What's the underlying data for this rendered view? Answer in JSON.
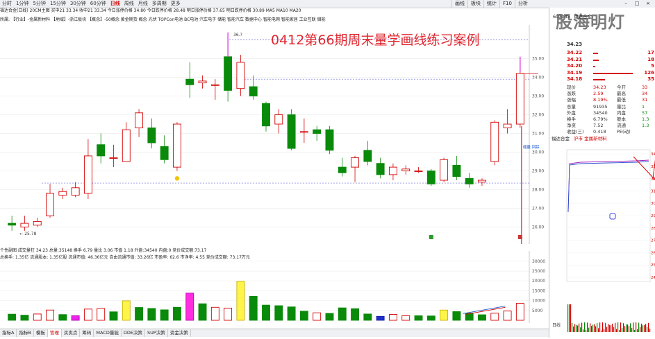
{
  "topbar": {
    "periods": [
      "1分钟",
      "5分钟",
      "15分钟",
      "30分钟",
      "60分钟",
      "日线",
      "周线",
      "月线",
      "多周期",
      "更多"
    ],
    "periods_prefix": [
      "分时",
      "1分钟"
    ],
    "active_period": "日线",
    "tools": [
      "画线",
      "板块",
      "统计",
      "F10",
      "分析"
    ]
  },
  "infobar": {
    "text": "福达合金(日线)  20CM主图  买中21  33.34  收中21  33.34  今日涨停价格 34.80  今日跌停价格 28.48  明日涨停价格 37.65  明日跌停价格 30.89  MA5  MA10  MA20"
  },
  "conceptbar": {
    "text": "所属:  【行业】-金属新材料 【地域】-浙江板块  【概念】-50概念 黄金期货 概念 光伏 TOPCon电池 BC电池 汽车电子 储能 智能汽车 数据中心 智能电网 智能家居 工业互联 储能"
  },
  "overlay_title": "0412第66期周末量学画线练习案例",
  "price_axis": [
    "35.00",
    "34.00",
    "33.00",
    "32.00",
    "31.00",
    "30.00",
    "29.00",
    "28.00",
    "27.00",
    "26.00"
  ],
  "annotations": {
    "high": "36.?",
    "low": "25.78",
    "note": "缩量 回踩"
  },
  "indicator_bar": {
    "text": "个性副图  成交量柱  34.23  总量:35148  换手 6.79  量比 3.06  市值 1.18  外盘:34540  内盘:0  竞价成交额:73.17"
  },
  "stat_bar": {
    "text": "总换手:  1.35亿  流通股本:  1.35亿股   流通市值:  46.36亿元    自由流通市值:  33.26亿          市盈率:  62.6      市净率:  4.55           竞价成交额:  73.17万元"
  },
  "volume_axis": [
    "30000",
    "25000",
    "20000",
    "15000",
    "10000",
    "5000"
  ],
  "bottom_tabs": [
    "指标A",
    "指标B",
    "模板",
    "管理",
    "买卖点",
    "筹码",
    "MACD量能",
    "DDE决策",
    "SUP决策",
    "资金决策"
  ],
  "active_bottom_tab": "管理",
  "right_panel": {
    "logo": "股海明灯",
    "stock_code": "603045",
    "stock_name": "福达合金",
    "orderbook": [
      {
        "price": "34.22",
        "vol": "17"
      },
      {
        "price": "34.21",
        "vol": "18"
      },
      {
        "price": "34.20",
        "vol": "5"
      },
      {
        "price": "34.19",
        "vol": "126"
      },
      {
        "price": "34.18",
        "vol": "35"
      }
    ],
    "orderbook_bars": [
      0.12,
      0.13,
      0.05,
      0.95,
      0.28
    ],
    "top_labels": [
      "34.23"
    ],
    "quote": [
      [
        "现价",
        "34.23",
        "今开",
        "33"
      ],
      [
        "涨跌",
        "2.59",
        "最高",
        "34"
      ],
      [
        "涨幅",
        "8.19%",
        "最低",
        "31"
      ],
      [
        "总量",
        "91935",
        "量比",
        "1"
      ],
      [
        "外盘",
        "34540",
        "内盘",
        "57"
      ],
      [
        "换手",
        "6.79%",
        "股本",
        "1.3"
      ],
      [
        "净资",
        "7.52",
        "流通",
        "1.3"
      ],
      [
        "收益(三)",
        "0.418",
        "PE(动)",
        ""
      ]
    ],
    "mini_title": "福达合金",
    "mini_sub": "沪市 金属新材料",
    "mini_axis": [
      "34",
      "33",
      "32",
      "31",
      "30",
      "29",
      "28",
      "27",
      "26",
      "25",
      "24"
    ],
    "bottom_label": "日线"
  },
  "chart_data": {
    "type": "candlestick",
    "candles": [
      {
        "o": 26.2,
        "c": 26.1,
        "h": 26.6,
        "l": 25.8
      },
      {
        "o": 26.0,
        "c": 26.2,
        "h": 26.6,
        "l": 25.8
      },
      {
        "o": 26.1,
        "c": 26.3,
        "h": 26.5,
        "l": 26.0
      },
      {
        "o": 26.6,
        "c": 27.8,
        "h": 28.3,
        "l": 26.5
      },
      {
        "o": 27.7,
        "c": 27.9,
        "h": 28.1,
        "l": 27.5
      },
      {
        "o": 27.7,
        "c": 28.1,
        "h": 28.4,
        "l": 27.6
      },
      {
        "o": 27.8,
        "c": 29.8,
        "h": 30.7,
        "l": 27.5
      },
      {
        "o": 30.4,
        "c": 29.8,
        "h": 31.0,
        "l": 29.4
      },
      {
        "o": 29.7,
        "c": 29.7,
        "h": 30.4,
        "l": 29.2
      },
      {
        "o": 29.5,
        "c": 31.2,
        "h": 31.6,
        "l": 29.5
      },
      {
        "o": 31.3,
        "c": 32.1,
        "h": 32.3,
        "l": 30.8
      },
      {
        "o": 31.3,
        "c": 30.5,
        "h": 31.8,
        "l": 30.2
      },
      {
        "o": 30.3,
        "c": 29.6,
        "h": 30.9,
        "l": 29.4
      },
      {
        "o": 29.2,
        "c": 31.5,
        "h": 31.6,
        "l": 29.0
      },
      {
        "o": 33.9,
        "c": 33.6,
        "h": 34.8,
        "l": 32.9
      },
      {
        "o": 33.7,
        "c": 33.8,
        "h": 34.1,
        "l": 33.4
      },
      {
        "o": 33.6,
        "c": 33.6,
        "h": 33.9,
        "l": 32.8
      },
      {
        "o": 35.1,
        "c": 33.3,
        "h": 36.2,
        "l": 32.7
      },
      {
        "o": 33.4,
        "c": 34.8,
        "h": 35.2,
        "l": 33.0
      },
      {
        "o": 33.5,
        "c": 33.0,
        "h": 34.1,
        "l": 32.8
      },
      {
        "o": 32.6,
        "c": 31.4,
        "h": 32.7,
        "l": 31.1
      },
      {
        "o": 31.5,
        "c": 32.0,
        "h": 32.3,
        "l": 31.0
      },
      {
        "o": 32.0,
        "c": 30.2,
        "h": 32.3,
        "l": 30.1
      },
      {
        "o": 31.1,
        "c": 31.1,
        "h": 31.8,
        "l": 30.5
      },
      {
        "o": 31.2,
        "c": 31.0,
        "h": 31.4,
        "l": 30.6
      },
      {
        "o": 31.2,
        "c": 30.1,
        "h": 31.4,
        "l": 29.9
      },
      {
        "o": 29.2,
        "c": 28.9,
        "h": 29.7,
        "l": 28.7
      },
      {
        "o": 29.2,
        "c": 29.7,
        "h": 29.8,
        "l": 28.4
      },
      {
        "o": 30.1,
        "c": 29.5,
        "h": 30.6,
        "l": 29.3
      },
      {
        "o": 29.4,
        "c": 28.8,
        "h": 29.7,
        "l": 28.6
      },
      {
        "o": 28.8,
        "c": 29.2,
        "h": 29.4,
        "l": 28.5
      },
      {
        "o": 29.0,
        "c": 29.1,
        "h": 29.3,
        "l": 28.8
      },
      {
        "o": 29.0,
        "c": 29.0,
        "h": 29.2,
        "l": 28.9
      },
      {
        "o": 29.0,
        "c": 28.3,
        "h": 29.1,
        "l": 28.2
      },
      {
        "o": 28.5,
        "c": 29.6,
        "h": 29.7,
        "l": 28.4
      },
      {
        "o": 29.3,
        "c": 28.7,
        "h": 29.8,
        "l": 28.5
      },
      {
        "o": 28.6,
        "c": 28.3,
        "h": 28.9,
        "l": 28.1
      },
      {
        "o": 28.4,
        "c": 28.5,
        "h": 28.6,
        "l": 28.2
      },
      {
        "o": 29.5,
        "c": 31.6,
        "h": 31.7,
        "l": 29.3
      },
      {
        "o": 31.3,
        "c": 31.5,
        "h": 32.3,
        "l": 31.0
      },
      {
        "o": 31.5,
        "c": 34.2,
        "h": 34.9,
        "l": 31.3
      }
    ],
    "volumes": [
      {
        "v": 3100,
        "c": "g"
      },
      {
        "v": 2600,
        "c": "g"
      },
      {
        "v": 3200,
        "c": "r"
      },
      {
        "v": 5200,
        "c": "r"
      },
      {
        "v": 2900,
        "c": "g"
      },
      {
        "v": 2300,
        "c": "m"
      },
      {
        "v": 5700,
        "c": "r"
      },
      {
        "v": 6000,
        "c": "r"
      },
      {
        "v": 4300,
        "c": "g"
      },
      {
        "v": 9900,
        "c": "y"
      },
      {
        "v": 6500,
        "c": "g"
      },
      {
        "v": 6000,
        "c": "g"
      },
      {
        "v": 5300,
        "c": "g"
      },
      {
        "v": 6600,
        "c": "g"
      },
      {
        "v": 13800,
        "c": "p"
      },
      {
        "v": 8400,
        "c": "g"
      },
      {
        "v": 6600,
        "c": "r"
      },
      {
        "v": 6200,
        "c": "r"
      },
      {
        "v": 19800,
        "c": "y"
      },
      {
        "v": 12200,
        "c": "g"
      },
      {
        "v": 7700,
        "c": "g"
      },
      {
        "v": 7400,
        "c": "g"
      },
      {
        "v": 6800,
        "c": "g"
      },
      {
        "v": 4600,
        "c": "g"
      },
      {
        "v": 3800,
        "c": "r"
      },
      {
        "v": 3500,
        "c": "g"
      },
      {
        "v": 6300,
        "c": "g"
      },
      {
        "v": 5900,
        "c": "g"
      },
      {
        "v": 3200,
        "c": "g"
      },
      {
        "v": 2000,
        "c": "b"
      },
      {
        "v": 3000,
        "c": "r"
      },
      {
        "v": 2300,
        "c": "r"
      },
      {
        "v": 2300,
        "c": "g"
      },
      {
        "v": 2200,
        "c": "g"
      },
      {
        "v": 5200,
        "c": "y"
      },
      {
        "v": 4400,
        "c": "g"
      },
      {
        "v": 3600,
        "c": "g"
      },
      {
        "v": 2800,
        "c": "g"
      },
      {
        "v": 3600,
        "c": "r"
      },
      {
        "v": 4700,
        "c": "r"
      },
      {
        "v": 8600,
        "c": "r"
      }
    ],
    "ylim": [
      25.5,
      36.5
    ],
    "volume_ylim": [
      0,
      31000
    ]
  }
}
